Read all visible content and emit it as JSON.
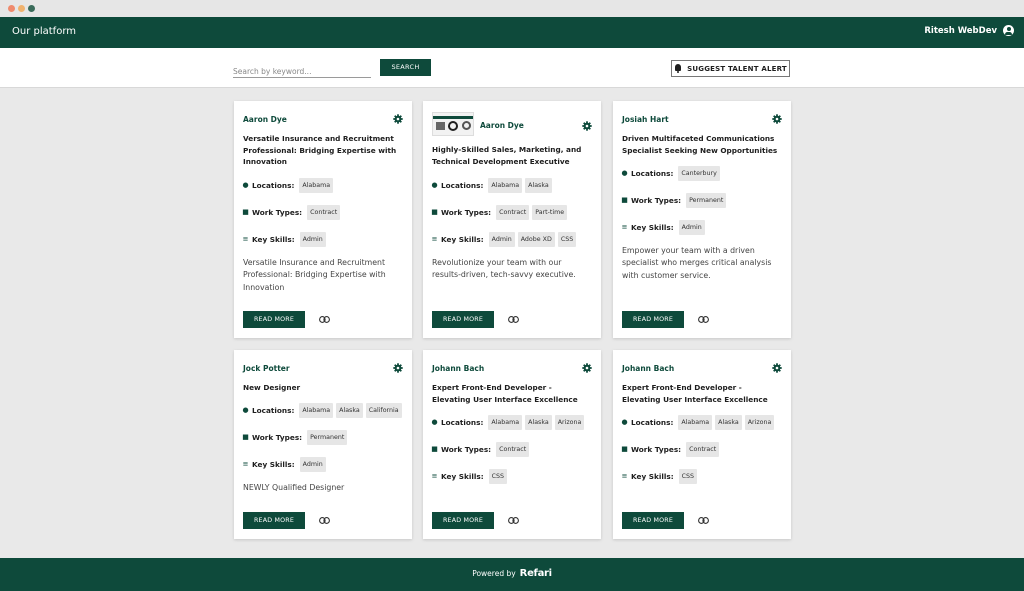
{
  "header": {
    "brand": "Our platform",
    "user_name": "Ritesh WebDev"
  },
  "search": {
    "placeholder": "Search by keyword...",
    "button_label": "SEARCH",
    "alert_label": "SUGGEST TALENT ALERT"
  },
  "labels": {
    "locations": "Locations:",
    "work_types": "Work Types:",
    "key_skills": "Key Skills:",
    "read_more": "READ MORE"
  },
  "cards": [
    {
      "name": "Aaron Dye",
      "title": "Versatile Insurance and Recruitment Professional: Bridging Expertise with Innovation",
      "locations": [
        "Alabama"
      ],
      "work_types": [
        "Contract"
      ],
      "skills": [
        "Admin"
      ],
      "description": "Versatile Insurance and Recruitment Professional: Bridging Expertise with Innovation"
    },
    {
      "name": "Aaron Dye",
      "title": "Highly-Skilled Sales, Marketing, and Technical Development Executive",
      "locations": [
        "Alabama",
        "Alaska"
      ],
      "work_types": [
        "Contract",
        "Part-time"
      ],
      "skills": [
        "Admin",
        "Adobe XD",
        "CSS"
      ],
      "description": "Revolutionize your team with our results-driven, tech-savvy executive."
    },
    {
      "name": "Josiah Hart",
      "title": "Driven Multifaceted Communications Specialist Seeking New Opportunities",
      "locations": [
        "Canterbury"
      ],
      "work_types": [
        "Permanent"
      ],
      "skills": [
        "Admin"
      ],
      "description": "Empower your team with a driven specialist who merges critical analysis with customer service."
    },
    {
      "name": "Jock Potter",
      "title": "New Designer",
      "locations": [
        "Alabama",
        "Alaska",
        "California"
      ],
      "work_types": [
        "Permanent"
      ],
      "skills": [
        "Admin"
      ],
      "description": "NEWLY Qualified Designer"
    },
    {
      "name": "Johann Bach",
      "title": "Expert Front-End Developer - Elevating User Interface Excellence",
      "locations": [
        "Alabama",
        "Alaska",
        "Arizona"
      ],
      "work_types": [
        "Contract"
      ],
      "skills": [
        "CSS"
      ],
      "description": ""
    },
    {
      "name": "Johann Bach",
      "title": "Expert Front-End Developer - Elevating User Interface Excellence",
      "locations": [
        "Alabama",
        "Alaska",
        "Arizona"
      ],
      "work_types": [
        "Contract"
      ],
      "skills": [
        "CSS"
      ],
      "description": ""
    }
  ],
  "footer": {
    "powered_by": "Powered by",
    "logo": "Refari"
  },
  "colors": {
    "brand": "#0e4a3b",
    "background": "#e9e9e9",
    "tag": "#e6e6e6"
  },
  "icons": {
    "settings": "gear-icon",
    "location": "map-pin-icon",
    "work": "briefcase-icon",
    "skills": "list-icon",
    "link": "link-icon",
    "alert": "bell-icon",
    "user": "user-circle-icon"
  }
}
